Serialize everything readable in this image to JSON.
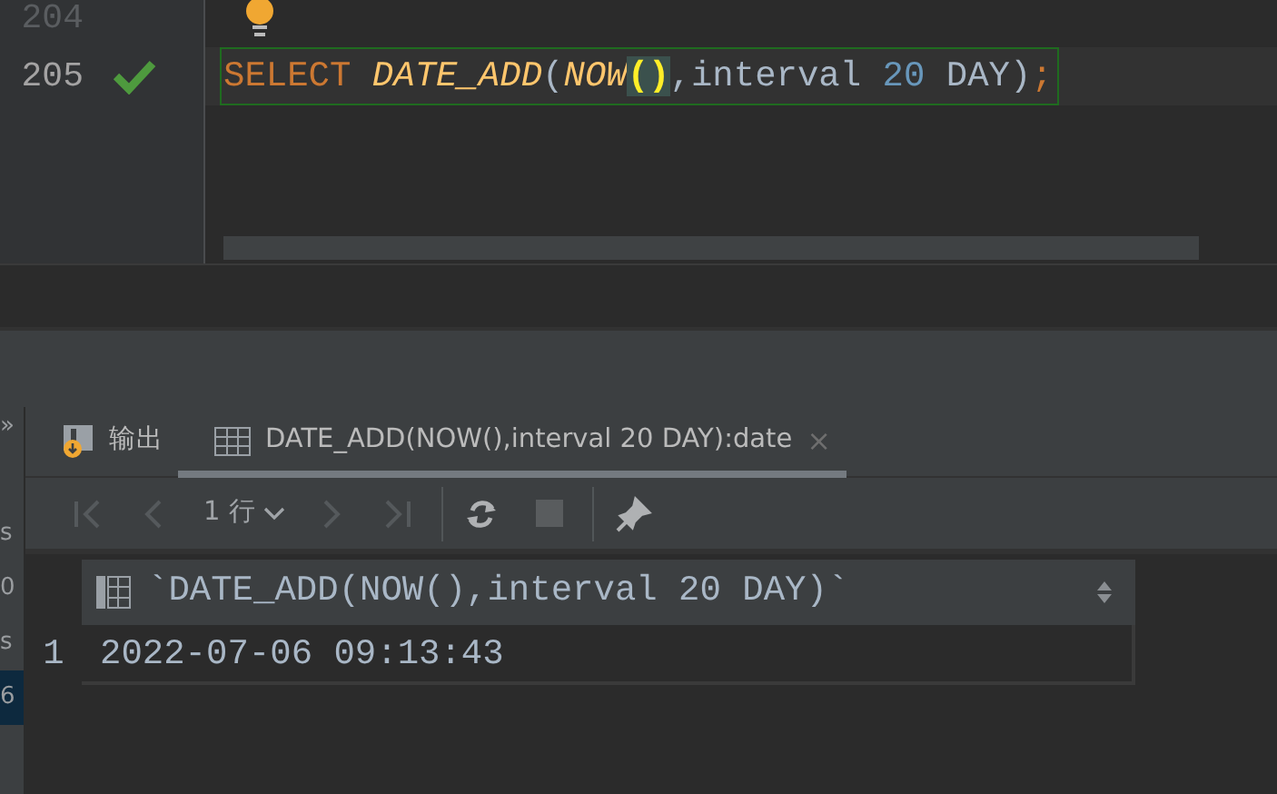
{
  "editor": {
    "lines": [
      {
        "number": "204",
        "current": false,
        "valid": false,
        "bulb": true
      },
      {
        "number": "205",
        "current": true,
        "valid": true,
        "bulb": false,
        "tokens": [
          {
            "text": "SELECT ",
            "kind": "keyword"
          },
          {
            "text": "DATE_ADD",
            "kind": "function"
          },
          {
            "text": "(",
            "kind": "paren"
          },
          {
            "text": "NOW",
            "kind": "function"
          },
          {
            "text": "()",
            "kind": "brace_match"
          },
          {
            "text": ",interval ",
            "kind": "plain"
          },
          {
            "text": "20",
            "kind": "number"
          },
          {
            "text": " DAY",
            "kind": "plain"
          },
          {
            "text": ")",
            "kind": "paren"
          },
          {
            "text": ";",
            "kind": "keyword"
          }
        ]
      }
    ]
  },
  "side_strip": {
    "toggle": "»",
    "fragments": [
      {
        "text": "s",
        "selected": false
      },
      {
        "text": "0",
        "selected": false
      },
      {
        "text": "s",
        "selected": false
      },
      {
        "text": "6",
        "selected": true
      }
    ]
  },
  "tabs": [
    {
      "label": "输出",
      "kind": "output",
      "selected": false
    },
    {
      "label": "DATE_ADD(NOW(),interval 20 DAY):date",
      "kind": "result",
      "selected": true,
      "close": "×"
    }
  ],
  "toolbar": {
    "page_size": "1 行",
    "buttons": [
      {
        "kind": "first",
        "disabled": true
      },
      {
        "kind": "prev",
        "disabled": true
      },
      {
        "kind": "pagesize"
      },
      {
        "kind": "next",
        "disabled": true
      },
      {
        "kind": "last",
        "disabled": true
      },
      {
        "kind": "sep"
      },
      {
        "kind": "refresh",
        "disabled": false
      },
      {
        "kind": "stop",
        "disabled": true
      },
      {
        "kind": "sep"
      },
      {
        "kind": "pin",
        "disabled": false
      }
    ]
  },
  "grid": {
    "columns": [
      "`DATE_ADD(NOW(),interval 20 DAY)`"
    ],
    "rows": [
      {
        "number": "1",
        "cells": [
          "2022-07-06 09:13:43"
        ]
      }
    ]
  }
}
